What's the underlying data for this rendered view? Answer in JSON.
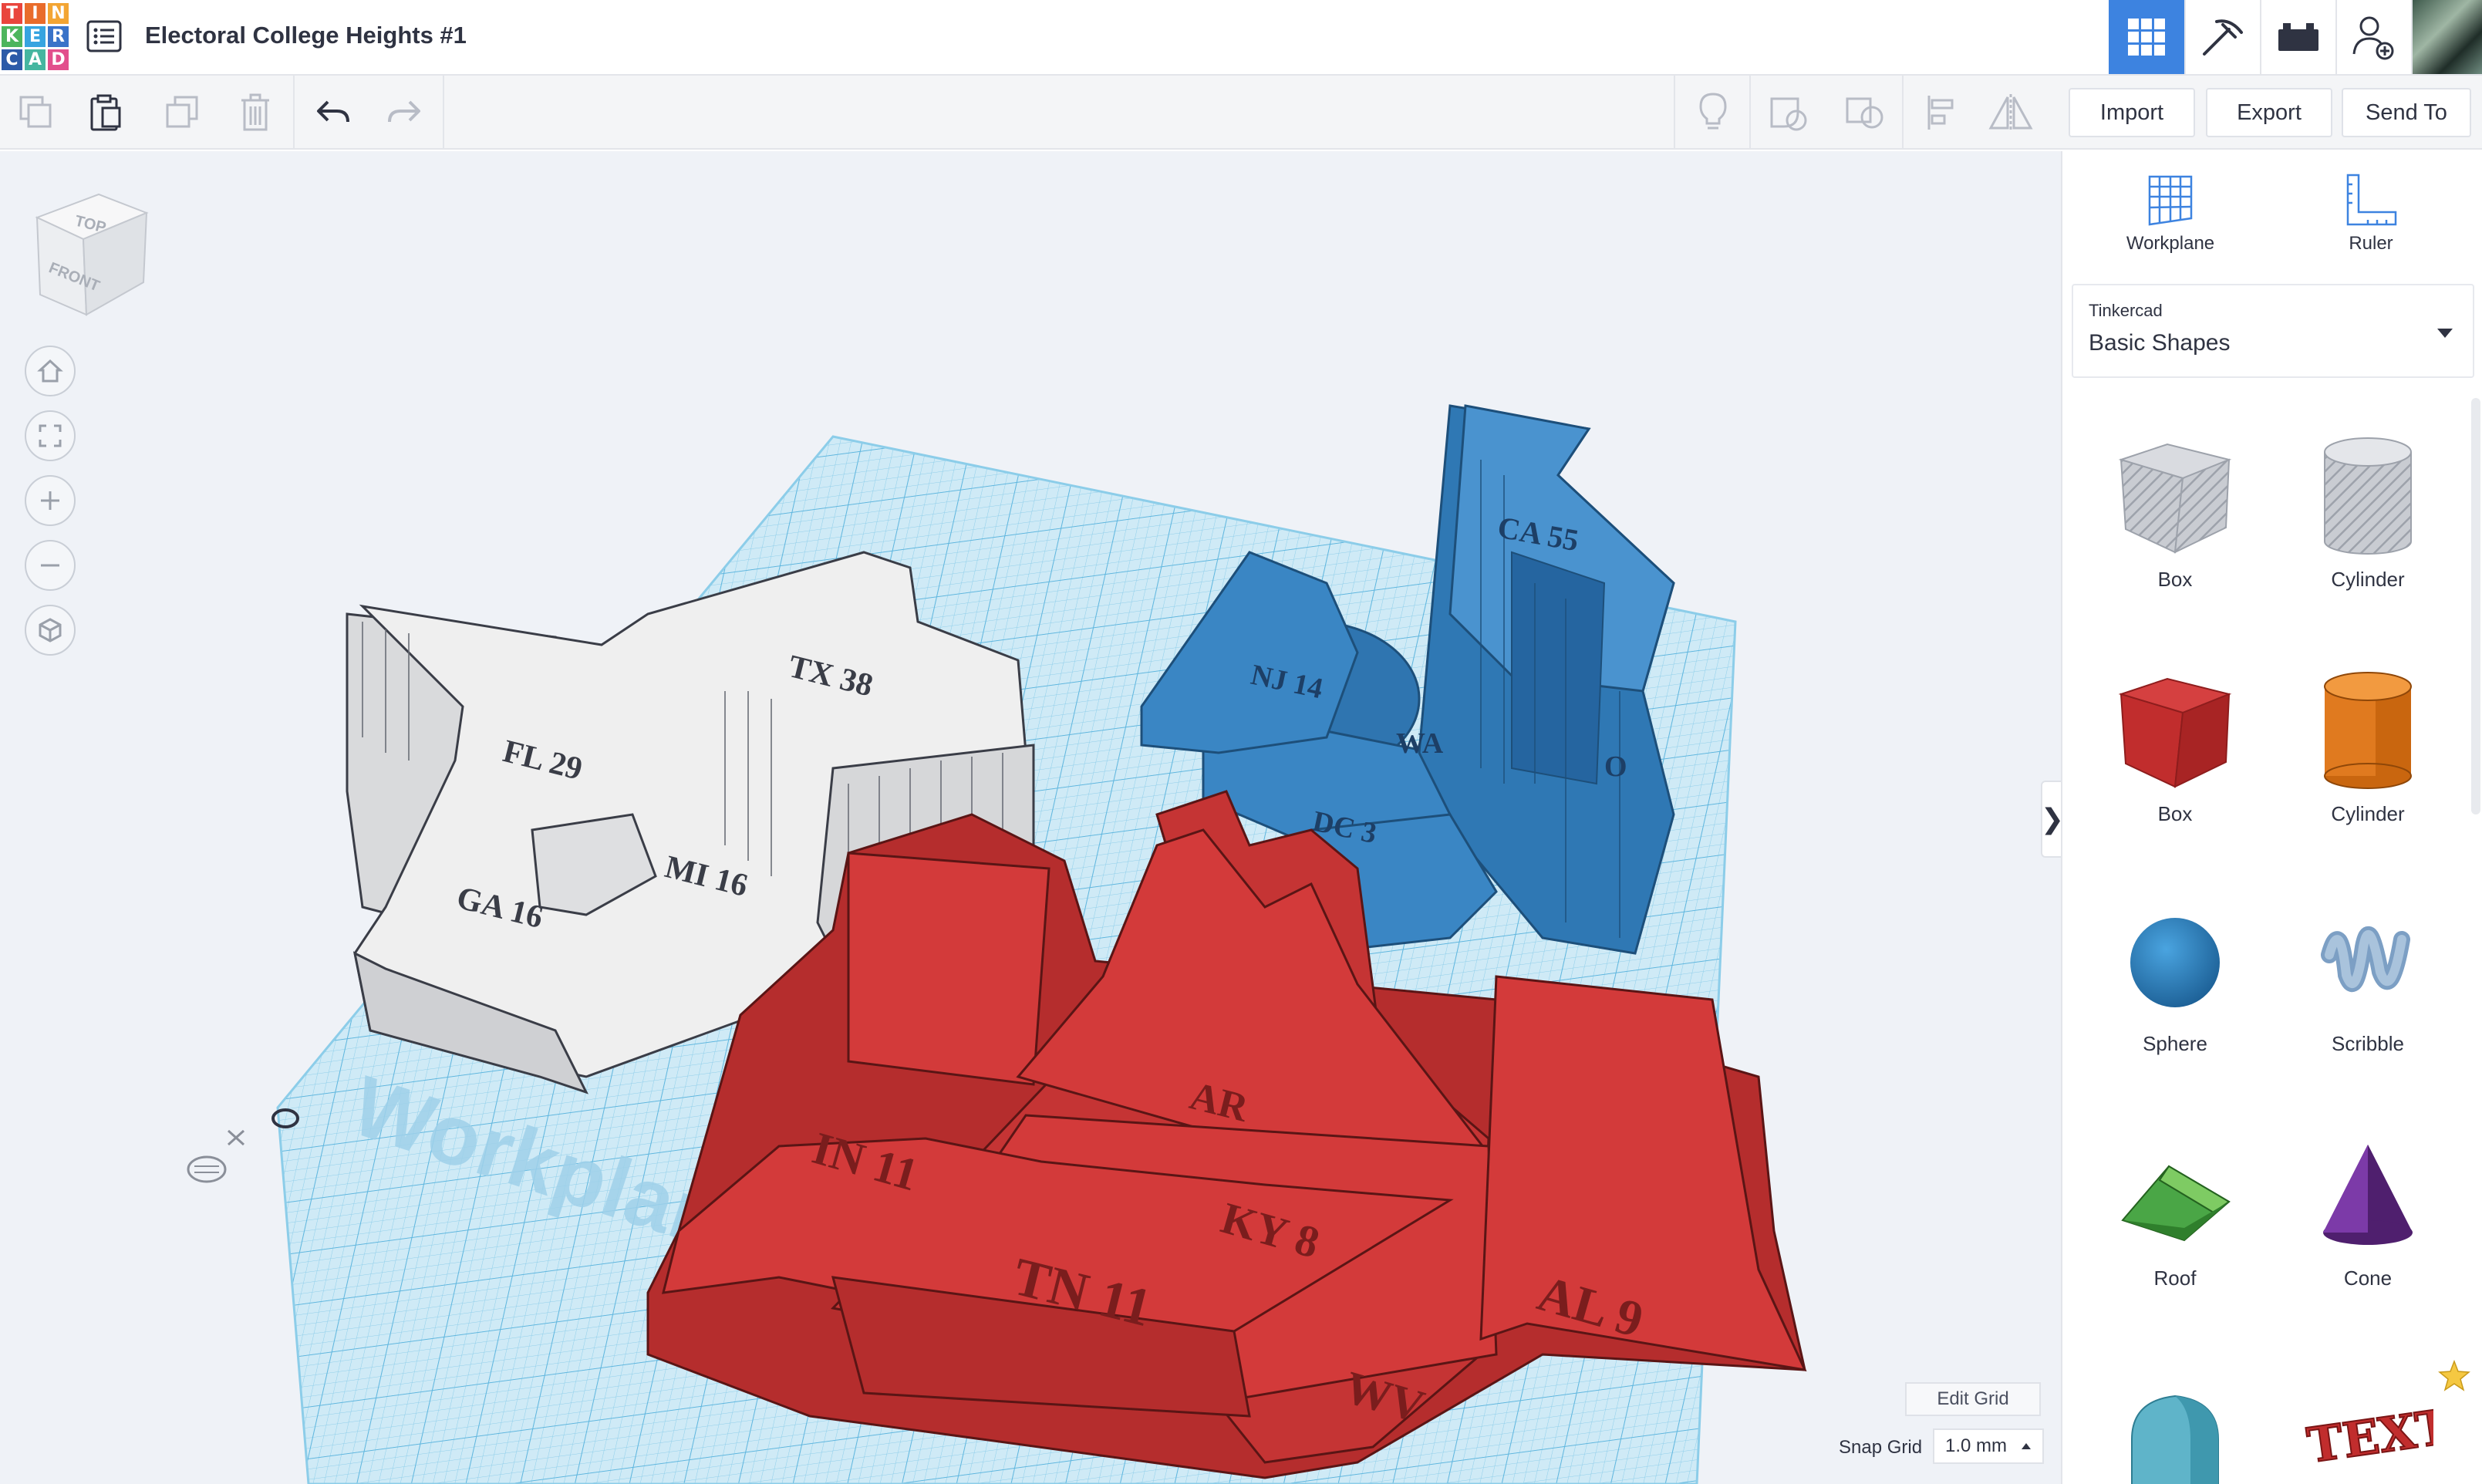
{
  "app": {
    "logo_letters": [
      "T",
      "I",
      "N",
      "K",
      "E",
      "R",
      "C",
      "A",
      "D"
    ],
    "logo_colors": [
      "#e9453d",
      "#e96c2b",
      "#f3a533",
      "#4db55d",
      "#37a4e0",
      "#3a73c8",
      "#2c5ba8",
      "#45b6a0",
      "#e24f8c"
    ],
    "design_title": "Electoral College Heights #1"
  },
  "header": {
    "modes": [
      {
        "name": "3d-view-icon",
        "active": true
      },
      {
        "name": "blocks-icon",
        "active": false
      },
      {
        "name": "bricks-icon",
        "active": false
      },
      {
        "name": "add-user-icon",
        "active": false
      }
    ]
  },
  "toolbar": {
    "import_label": "Import",
    "export_label": "Export",
    "send_to_label": "Send To"
  },
  "viewport": {
    "navcube_top": "TOP",
    "navcube_front": "FRONT",
    "workplane_watermark": "Workplane",
    "edit_grid_label": "Edit Grid",
    "snap_grid_label": "Snap Grid",
    "snap_grid_value": "1.0 mm",
    "collapse_glyph": "❯",
    "white_labels": [
      "TX 38",
      "FL 29",
      "GA 16",
      "MI 16"
    ],
    "blue_labels": [
      "CA 55",
      "NJ 14",
      "DC 3",
      "WA",
      "O"
    ],
    "red_labels": [
      "IN 11",
      "KY 8",
      "TN 11",
      "AL 9",
      "WV",
      "AR"
    ],
    "colors": {
      "white_state": "#efefef",
      "blue_state": "#3a86c4",
      "red_state": "#d33a3a",
      "grid": "#bfe2f3"
    }
  },
  "panel": {
    "workplane_label": "Workplane",
    "ruler_label": "Ruler",
    "library_vendor": "Tinkercad",
    "library_name": "Basic Shapes",
    "shapes": [
      {
        "label": "Box",
        "icon": "box-hole-icon"
      },
      {
        "label": "Cylinder",
        "icon": "cylinder-hole-icon"
      },
      {
        "label": "Box",
        "icon": "box-icon"
      },
      {
        "label": "Cylinder",
        "icon": "cylinder-icon"
      },
      {
        "label": "Sphere",
        "icon": "sphere-icon"
      },
      {
        "label": "Scribble",
        "icon": "scribble-icon"
      },
      {
        "label": "Roof",
        "icon": "roof-icon"
      },
      {
        "label": "Cone",
        "icon": "cone-icon"
      },
      {
        "label": "",
        "icon": "round-roof-icon"
      },
      {
        "label": "",
        "icon": "text-icon"
      }
    ],
    "text_shape_glyph": "TEXT"
  }
}
